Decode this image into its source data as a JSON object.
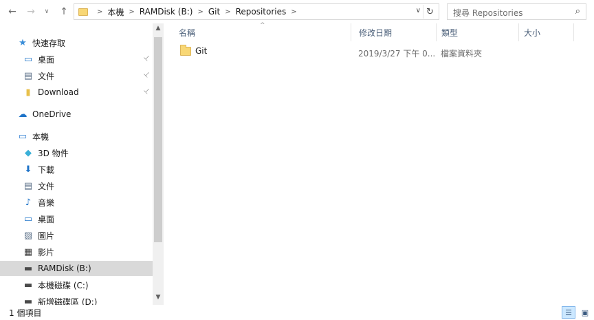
{
  "toolbar": {
    "back_glyph": "←",
    "forward_glyph": "→",
    "recent_glyph": "∨",
    "up_glyph": "↑"
  },
  "address": {
    "crumbs": [
      "本機",
      "RAMDisk (B:)",
      "Git",
      "Repositories"
    ],
    "separator": ">",
    "dropdown_glyph": "∨",
    "refresh_glyph": "↻"
  },
  "search": {
    "placeholder": "搜尋 Repositories",
    "icon_glyph": "⌕"
  },
  "nav": {
    "items": [
      {
        "label": "快速存取",
        "icon": "star-icon",
        "glyph": "★",
        "color": "#3b8ed8",
        "indent": 1,
        "pinned": false
      },
      {
        "label": "桌面",
        "icon": "desktop-icon",
        "glyph": "▭",
        "color": "#1e73c8",
        "indent": 2,
        "pinned": true
      },
      {
        "label": "文件",
        "icon": "documents-icon",
        "glyph": "▤",
        "color": "#5c7088",
        "indent": 2,
        "pinned": true
      },
      {
        "label": "Download",
        "icon": "folder-icon",
        "glyph": "▮",
        "color": "#e8c04a",
        "indent": 2,
        "pinned": true
      },
      {
        "label": "OneDrive",
        "icon": "onedrive-icon",
        "glyph": "☁",
        "color": "#1e73c8",
        "indent": 1,
        "pinned": false
      },
      {
        "label": "本機",
        "icon": "this-pc-icon",
        "glyph": "▭",
        "color": "#2d7dd2",
        "indent": 1,
        "pinned": false
      },
      {
        "label": "3D 物件",
        "icon": "3d-objects-icon",
        "glyph": "◆",
        "color": "#3ab0d8",
        "indent": 2,
        "pinned": false
      },
      {
        "label": "下載",
        "icon": "downloads-icon",
        "glyph": "⬇",
        "color": "#1e73c8",
        "indent": 2,
        "pinned": false
      },
      {
        "label": "文件",
        "icon": "documents-icon",
        "glyph": "▤",
        "color": "#5c7088",
        "indent": 2,
        "pinned": false
      },
      {
        "label": "音樂",
        "icon": "music-icon",
        "glyph": "♪",
        "color": "#1e73c8",
        "indent": 2,
        "pinned": false
      },
      {
        "label": "桌面",
        "icon": "desktop-icon",
        "glyph": "▭",
        "color": "#1e73c8",
        "indent": 2,
        "pinned": false
      },
      {
        "label": "圖片",
        "icon": "pictures-icon",
        "glyph": "▨",
        "color": "#5c7088",
        "indent": 2,
        "pinned": false
      },
      {
        "label": "影片",
        "icon": "videos-icon",
        "glyph": "▦",
        "color": "#3a3a3a",
        "indent": 2,
        "pinned": false
      },
      {
        "label": "RAMDisk (B:)",
        "icon": "drive-icon",
        "glyph": "▬",
        "color": "#4a4a4a",
        "indent": 2,
        "pinned": false,
        "selected": true
      },
      {
        "label": "本機磁碟 (C:)",
        "icon": "drive-c-icon",
        "glyph": "▬",
        "color": "#4a4a4a",
        "indent": 2,
        "pinned": false
      },
      {
        "label": "新增磁碟區 (D:)",
        "icon": "drive-d-icon",
        "glyph": "▬",
        "color": "#4a4a4a",
        "indent": 2,
        "pinned": false
      }
    ],
    "pin_glyph": "📌"
  },
  "columns": {
    "name": "名稱",
    "modified": "修改日期",
    "type": "類型",
    "size": "大小",
    "sort_glyph": "^"
  },
  "files": [
    {
      "name": "Git",
      "modified": "2019/3/27 下午 0...",
      "type": "檔案資料夾",
      "size": ""
    }
  ],
  "status": {
    "text": "1 個項目"
  }
}
